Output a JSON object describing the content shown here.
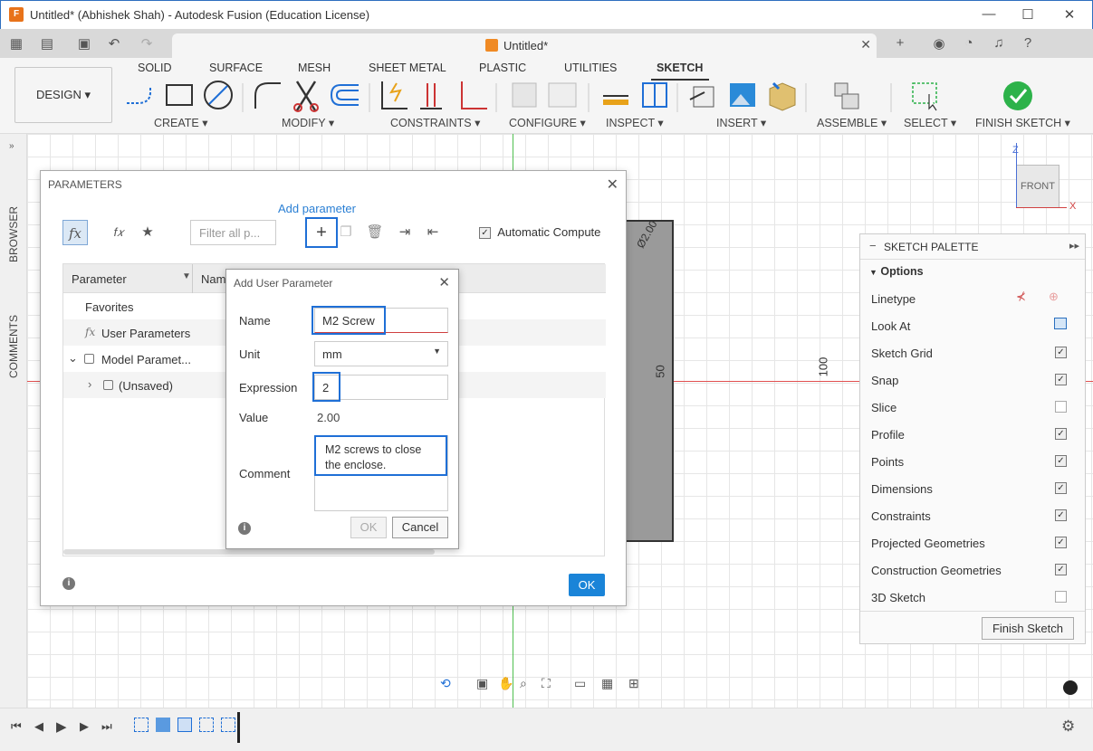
{
  "window": {
    "title": "Untitled* (Abhishek Shah) - Autodesk Fusion (Education License)",
    "logo_text": "F",
    "doc_tab": "Untitled*"
  },
  "ribbon": {
    "workspace": "DESIGN",
    "tabs": [
      "SOLID",
      "SURFACE",
      "MESH",
      "SHEET METAL",
      "PLASTIC",
      "UTILITIES",
      "SKETCH"
    ],
    "active_tab": "SKETCH",
    "groups": [
      "CREATE",
      "MODIFY",
      "CONSTRAINTS",
      "CONFIGURE",
      "INSPECT",
      "INSERT",
      "ASSEMBLE",
      "SELECT",
      "FINISH SKETCH"
    ]
  },
  "left_panels": {
    "browser": "BROWSER",
    "comments": "COMMENTS"
  },
  "canvas": {
    "view_cube": "FRONT",
    "axis_z": "Z",
    "axis_x": "X",
    "dim_50": "50",
    "dim_100": "100",
    "dim_dia": "Ø2.00"
  },
  "parameters_dialog": {
    "title": "PARAMETERS",
    "add_parameter_tooltip": "Add parameter",
    "filter_placeholder": "Filter all p...",
    "automatic_compute": "Automatic Compute",
    "columns": [
      "Parameter",
      "Name"
    ],
    "rows": [
      {
        "label": "Favorites"
      },
      {
        "label": "User Parameters"
      },
      {
        "label": "Model Paramet..."
      },
      {
        "label": "(Unsaved)"
      }
    ],
    "ok": "OK"
  },
  "add_user_parameter": {
    "title": "Add User Parameter",
    "name_label": "Name",
    "name_value": "M2 Screw",
    "unit_label": "Unit",
    "unit_value": "mm",
    "expression_label": "Expression",
    "expression_value": "2",
    "value_label": "Value",
    "value_value": "2.00",
    "comment_label": "Comment",
    "comment_value": "M2 screws to close the enclose.",
    "ok": "OK",
    "cancel": "Cancel"
  },
  "sketch_palette": {
    "title": "SKETCH PALETTE",
    "section": "Options",
    "rows": [
      {
        "label": "Linetype"
      },
      {
        "label": "Look At"
      },
      {
        "label": "Sketch Grid",
        "checked": true
      },
      {
        "label": "Snap",
        "checked": true
      },
      {
        "label": "Slice",
        "checked": false
      },
      {
        "label": "Profile",
        "checked": true
      },
      {
        "label": "Points",
        "checked": true
      },
      {
        "label": "Dimensions",
        "checked": true
      },
      {
        "label": "Constraints",
        "checked": true
      },
      {
        "label": "Projected Geometries",
        "checked": true
      },
      {
        "label": "Construction Geometries",
        "checked": true
      },
      {
        "label": "3D Sketch",
        "checked": false
      }
    ],
    "finish_button": "Finish Sketch"
  },
  "colors": {
    "accent": "#1f6fd6",
    "ok_button": "#1a84d8",
    "finish_check": "#2db24a",
    "canvas_redline": "#e05050",
    "canvas_greenline": "#4fbf4f"
  }
}
